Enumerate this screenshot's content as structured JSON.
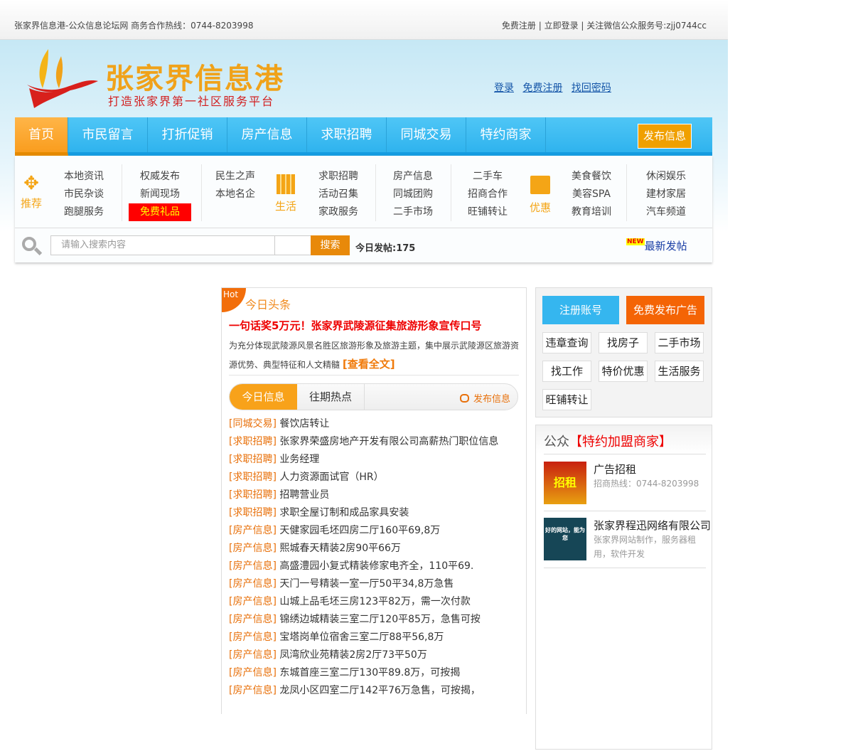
{
  "topbar": {
    "left": "张家界信息港-公众信息论坛网 商务合作热线：0744-8203998",
    "right": "免费注册 | 立即登录 | 关注微信公众服务号:zjj0744cc"
  },
  "header": {
    "brand": "张家界信息港",
    "slogan": "打造张家界第一社区服务平台",
    "links": [
      "登录",
      "免费注册",
      "找回密码"
    ]
  },
  "nav": {
    "items": [
      "首页",
      "市民留言",
      "打折促销",
      "房产信息",
      "求职招聘",
      "同城交易",
      "特约商家"
    ],
    "publish": "发布信息"
  },
  "submenu": {
    "cats": [
      "推荐",
      "生活",
      "优惠"
    ],
    "cols": [
      [
        "本地资讯",
        "市民杂谈",
        "跑腿服务"
      ],
      [
        "权威发布",
        "新闻现场",
        "免费礼品"
      ],
      [
        "民生之声",
        "本地名企"
      ],
      [
        "求职招聘",
        "活动召集",
        "家政服务"
      ],
      [
        "房产信息",
        "同城团购",
        "二手市场"
      ],
      [
        "二手车",
        "招商合作",
        "旺铺转让"
      ],
      [
        "美食餐饮",
        "美容SPA",
        "教育培训"
      ],
      [
        "休闲娱乐",
        "建材家居",
        "汽车频道"
      ]
    ]
  },
  "search": {
    "placeholder": "请输入搜索内容",
    "button": "搜索",
    "today": "今日发帖:175",
    "new_tag": "NEW",
    "newest": "最新发帖"
  },
  "headline": {
    "hot": "Hot",
    "title": "今日头条",
    "headline": "一句话奖5万元！张家界武陵源征集旅游形象宣传口号",
    "summary": "为充分体现武陵源风景名胜区旅游形象及旅游主题，集中展示武陵源区旅游资源优势、典型特征和人文精髓",
    "more": "[查看全文]"
  },
  "tabs": {
    "today": "今日信息",
    "past": "往期热点",
    "publish": "发布信息"
  },
  "list": [
    {
      "c": "[同城交易]",
      "t": "餐饮店转让"
    },
    {
      "c": "[求职招聘]",
      "t": "张家界荣盛房地产开发有限公司高薪热门职位信息"
    },
    {
      "c": "[求职招聘]",
      "t": "业务经理"
    },
    {
      "c": "[求职招聘]",
      "t": "人力资源面试官（HR）"
    },
    {
      "c": "[求职招聘]",
      "t": "招聘营业员"
    },
    {
      "c": "[求职招聘]",
      "t": "求职全屋订制和成品家具安装"
    },
    {
      "c": "[房产信息]",
      "t": "天健家园毛坯四房二厅160平69,8万"
    },
    {
      "c": "[房产信息]",
      "t": "熙城春天精装2房90平66万"
    },
    {
      "c": "[房产信息]",
      "t": "高盛澧园小复式精装修家电齐全，110平69."
    },
    {
      "c": "[房产信息]",
      "t": "天门一号精装一室一厅50平34,8万急售"
    },
    {
      "c": "[房产信息]",
      "t": "山城上品毛坯三房123平82万，需一次付款"
    },
    {
      "c": "[房产信息]",
      "t": "锦绣边城精装三室二厅120平85万，急售可按"
    },
    {
      "c": "[房产信息]",
      "t": "宝塔岗单位宿舍三室二厅88平56,8万"
    },
    {
      "c": "[房产信息]",
      "t": "凤湾欣业苑精装2房2厅73平50万"
    },
    {
      "c": "[房产信息]",
      "t": "东城首座三室二厅130平89.8万，可按揭"
    },
    {
      "c": "[房产信息]",
      "t": "龙凤小区四室二厅142平76万急售，可按揭，"
    }
  ],
  "side": {
    "register": "注册账号",
    "free_ad": "免费发布广告",
    "quick": [
      "违章查询",
      "找房子",
      "二手市场",
      "找工作",
      "特价优惠",
      "生活服务",
      "旺铺转让"
    ],
    "merchants_prefix": "公众",
    "merchants_title": "【特约加盟商家】",
    "merchants": [
      {
        "name": "广告招租",
        "desc": "招商热线：0744-8203998",
        "img": "招租"
      },
      {
        "name": "张家界程迅网络有限公司",
        "desc": "张家界网站制作，服务器租用，软件开发",
        "img": "好的网站，能为您"
      }
    ]
  }
}
